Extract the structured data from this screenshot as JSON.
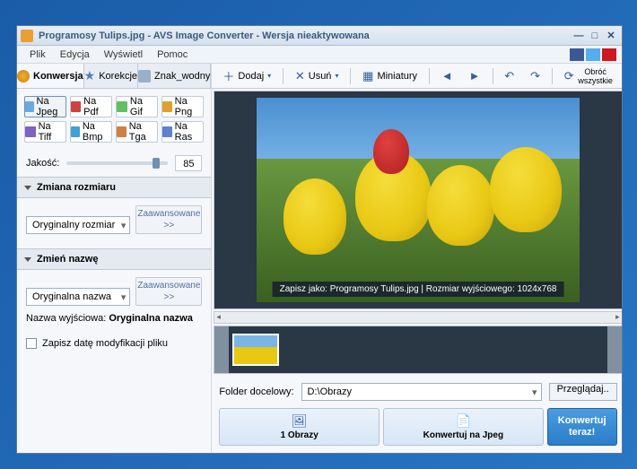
{
  "titlebar": {
    "title": "Programosy Tulips.jpg - AVS Image Converter - Wersja nieaktywowana"
  },
  "menu": {
    "items": [
      "Plik",
      "Edycja",
      "Wyświetl",
      "Pomoc"
    ]
  },
  "sidebar": {
    "tabs": {
      "conversion": "Konwersja",
      "corrections": "Korekcje",
      "watermark": "Znak_wodny"
    },
    "formats": {
      "jpeg": "Na Jpeg",
      "pdf": "Na Pdf",
      "gif": "Na Gif",
      "png": "Na Png",
      "tiff": "Na Tiff",
      "bmp": "Na Bmp",
      "tga": "Na Tga",
      "ras": "Na Ras"
    },
    "quality": {
      "label": "Jakość:",
      "value": "85"
    },
    "resize": {
      "header": "Zmiana rozmiaru",
      "combo": "Oryginalny rozmiar",
      "advanced": "Zaawansowane >>"
    },
    "rename": {
      "header": "Zmień nazwę",
      "combo": "Oryginalna nazwa",
      "advanced": "Zaawansowane >>",
      "output_label": "Nazwa wyjściowa:",
      "output_value": "Oryginalna nazwa"
    },
    "save_date": "Zapisz datę modyfikacji pliku"
  },
  "toolbar": {
    "add": "Dodaj",
    "remove": "Usuń",
    "thumbnails": "Miniatury",
    "rotate_all": "Obróć wszystkie"
  },
  "preview": {
    "caption": "Zapisz jako: Programosy Tulips.jpg | Rozmiar wyjściowego: 1024x768"
  },
  "footer": {
    "folder_label": "Folder docelowy:",
    "folder_value": "D:\\Obrazy",
    "browse": "Przeglądaj..",
    "images_count": "1 Obrazy",
    "convert_to": "Konwertuj na Jpeg",
    "convert_now": "Konwertuj teraz!"
  }
}
